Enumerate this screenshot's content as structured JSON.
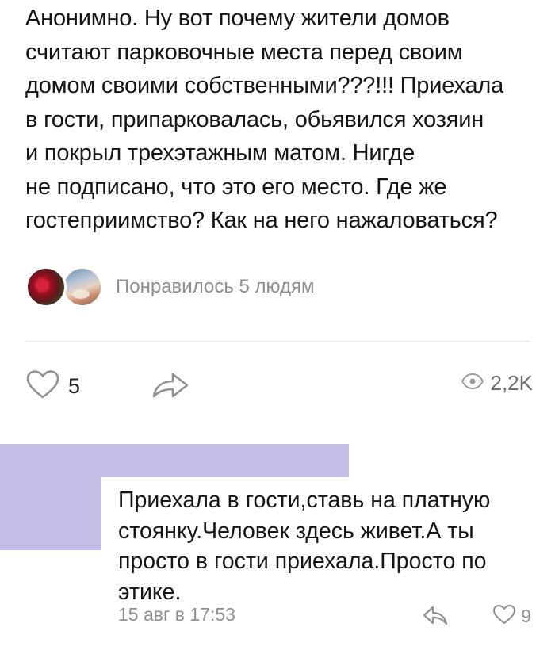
{
  "post": {
    "text": "Анонимно. Ну вот почему жители домов\nсчитают парковочные места перед своим\nдомом своими собственными???!!! Приехала\nв гости, припарковалась, обьявился хозяин\nи покрыл трехэтажным матом. Нигде\nне подписано, что это его место. Где же\nгостеприимство? Как на него нажаловаться?",
    "liked_by_text": "Понравилось 5 людям",
    "like_count": "5",
    "views": "2,2K"
  },
  "comment": {
    "text": "Приехала в гости,ставь на платную\nстоянку.Человек здесь живет.А ты\nпросто в гости приехала.Просто по\nэтике.",
    "date": "15 авг в 17:53",
    "like_count": "9"
  },
  "colors": {
    "quote_highlight": "#c5bde6",
    "muted_text": "#8c8f94",
    "divider": "#e6e7ea"
  },
  "icons": {
    "like": "heart-outline-icon",
    "share": "share-arrow-icon",
    "views": "eye-icon",
    "reply": "reply-arrow-icon"
  }
}
